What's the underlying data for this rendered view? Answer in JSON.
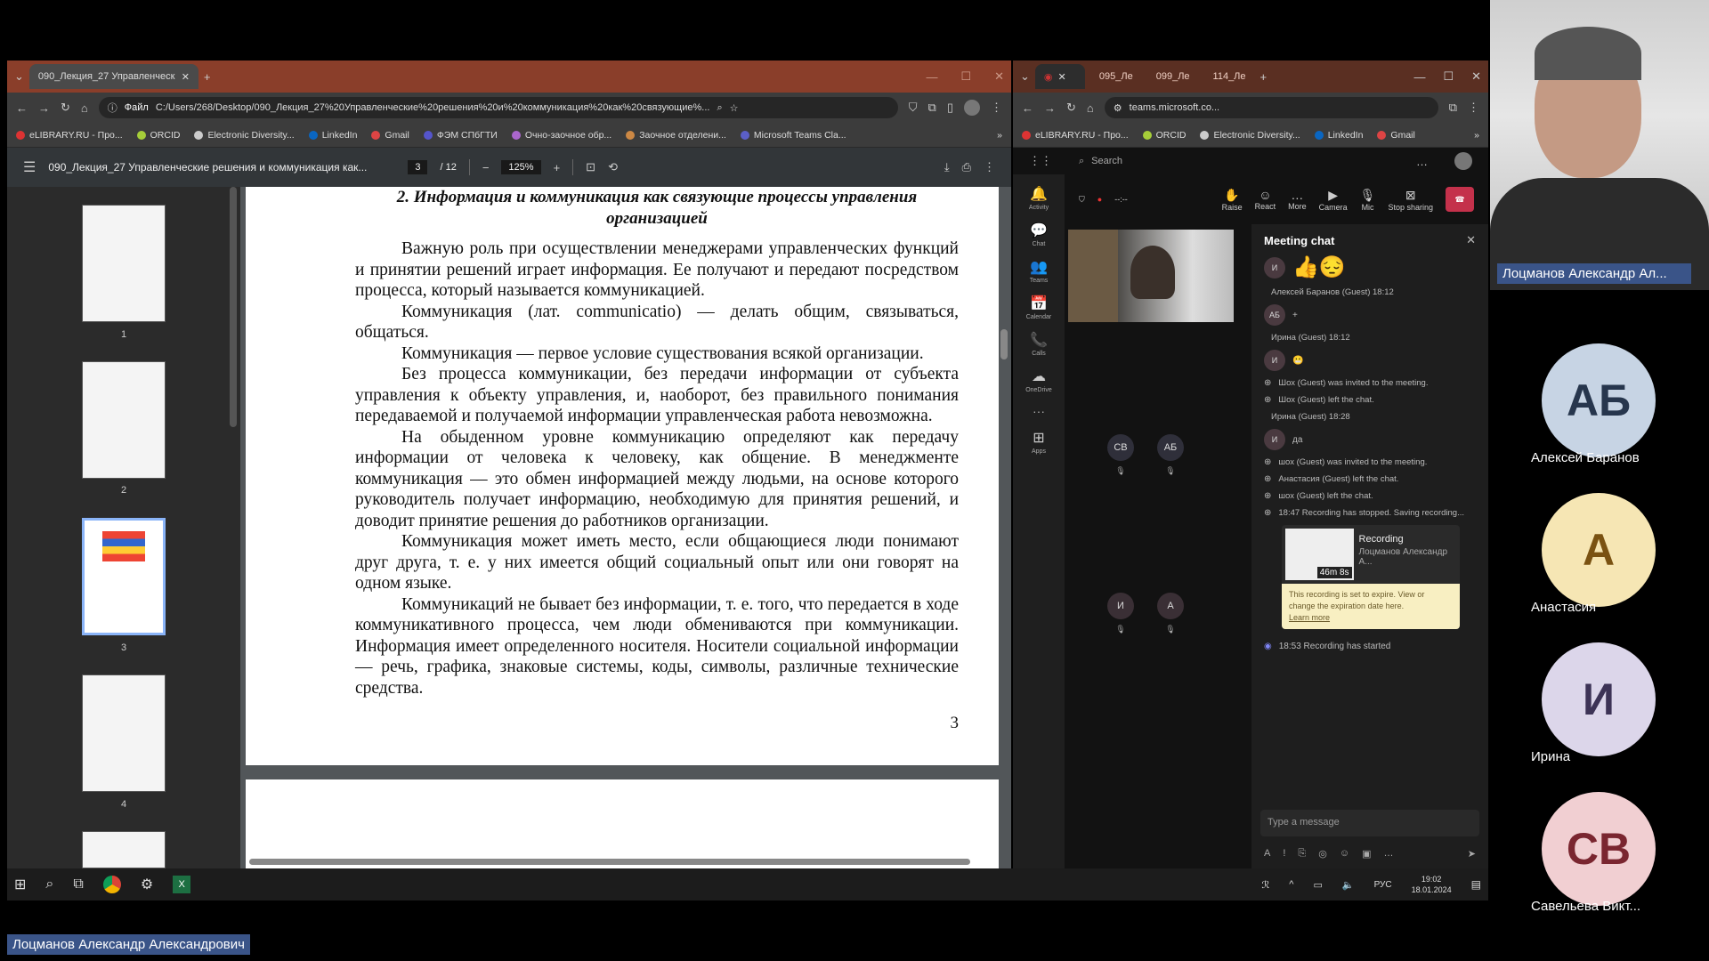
{
  "left_browser": {
    "tab_title": "090_Лекция_27 Управленческ",
    "url": "C:/Users/268/Desktop/090_Лекция_27%20Управленческие%20решения%20и%20коммуникация%20как%20связующие%...",
    "url_label": "Файл",
    "bookmarks": [
      "eLIBRARY.RU - Про...",
      "ORCID",
      "Electronic Diversity...",
      "LinkedIn",
      "Gmail",
      "ФЭМ СПбГТИ",
      "Очно-заочное обр...",
      "Заочное отделени...",
      "Microsoft Teams Cla..."
    ]
  },
  "pdf": {
    "file_title": "090_Лекция_27 Управленческие решения и коммуникация как...",
    "page_current": "3",
    "page_total": "/ 12",
    "zoom": "125%",
    "heading": "2. Информация и коммуникация как связующие процессы управления организацией",
    "paragraphs": [
      "Важную роль при осуществлении менеджерами управленческих функций и принятии решений играет информация. Ее получают и передают посредством процесса, который называется коммуникацией.",
      "Коммуникация (лат. communicatio) — делать общим, связываться, общаться.",
      "Коммуникация — первое условие существования всякой организации.",
      "Без процесса коммуникации, без передачи информации от субъекта управления к объекту управления, и, наоборот, без правильного понимания передаваемой и получаемой информации управленческая работа невозможна.",
      "На обыденном уровне коммуникацию определяют как передачу информации от человека к человеку, как общение. В менеджменте коммуникация — это обмен информацией между людьми, на основе которого руководитель получает информацию, необходимую для принятия решений, и доводит принятие решения до работников организации.",
      "Коммуникация может иметь место, если общающиеся люди понимают друг друга, т. е. у них имеется общий социальный опыт или они говорят на одном языке.",
      "Коммуникаций не бывает без информации, т. е. того, что передается в ходе коммуникативного процесса, чем люди обмениваются при коммуникации. Информация имеет определенного носителя. Носители социальной информации — речь, графика, знаковые системы, коды, символы, различные технические средства."
    ],
    "page_number": "3",
    "thumbnails": [
      "1",
      "2",
      "3",
      "4"
    ]
  },
  "right_browser": {
    "tabs": [
      "095_Ле",
      "099_Ле",
      "114_Ле"
    ],
    "url": "teams.microsoft.co...",
    "bookmarks": [
      "eLIBRARY.RU - Про...",
      "ORCID",
      "Electronic Diversity...",
      "LinkedIn",
      "Gmail"
    ]
  },
  "teams": {
    "search_placeholder": "Search",
    "rail": [
      "Activity",
      "Chat",
      "Teams",
      "Calendar",
      "Calls",
      "OneDrive",
      "Apps"
    ],
    "toolbar": {
      "timer": "--:--",
      "raise": "Raise",
      "react": "React",
      "more": "More",
      "camera": "Camera",
      "mic": "Mic",
      "stop_sharing": "Stop sharing"
    },
    "participants": [
      "СВ",
      "АБ",
      "И",
      "А"
    ],
    "chat_title": "Meeting chat",
    "chat": [
      {
        "kind": "avatar",
        "initials": "И",
        "emoji": "👍😔"
      },
      {
        "kind": "header",
        "text": "Алексей Баранов (Guest)   18:12"
      },
      {
        "kind": "avatar",
        "initials": "АБ",
        "emoji": "+"
      },
      {
        "kind": "header",
        "text": "Ирина (Guest)   18:12"
      },
      {
        "kind": "avatar",
        "initials": "И",
        "emoji": "😬"
      },
      {
        "kind": "event",
        "text": "Шох (Guest) was invited to the meeting."
      },
      {
        "kind": "event",
        "text": "Шох (Guest) left the chat."
      },
      {
        "kind": "header",
        "text": "Ирина (Guest)   18:28"
      },
      {
        "kind": "avatar",
        "initials": "И",
        "emoji": "да"
      },
      {
        "kind": "event",
        "text": "шох (Guest) was invited to the meeting."
      },
      {
        "kind": "event",
        "text": "Анастасия (Guest) left the chat."
      },
      {
        "kind": "event",
        "text": "шох (Guest) left the chat."
      },
      {
        "kind": "event",
        "text": "18:47   Recording has stopped. Saving recording..."
      }
    ],
    "recording": {
      "title": "Recording",
      "owner": "Лоцманов Александр А...",
      "duration": "46m 8s",
      "expire_notice": "This recording is set to expire. View or change the expiration date here.",
      "learn_more": "Learn more"
    },
    "recording_started": "18:53   Recording has started",
    "message_placeholder": "Type a message"
  },
  "taskbar": {
    "lang": "РУС",
    "time": "19:02",
    "date": "18.01.2024"
  },
  "presenter_label": "Лоцманов Александр Ал...",
  "bottom_name": "Лоцманов Александр Александрович",
  "tiles": [
    {
      "initials": "АБ",
      "name": "Алексей Баранов",
      "bg": "#c7d4e4",
      "fg": "#27364d"
    },
    {
      "initials": "А",
      "name": "Анастасия",
      "bg": "#f6e6b4",
      "fg": "#7a5212"
    },
    {
      "initials": "И",
      "name": "Ирина",
      "bg": "#dcd6ea",
      "fg": "#3d3356"
    },
    {
      "initials": "СВ",
      "name": "Савельева Викт...",
      "bg": "#f1cfd2",
      "fg": "#7a2630"
    }
  ],
  "colors": {
    "tab_strip": "#8a3e2a",
    "teams_accent": "#5b5fc7",
    "end_call": "#c4314b"
  }
}
